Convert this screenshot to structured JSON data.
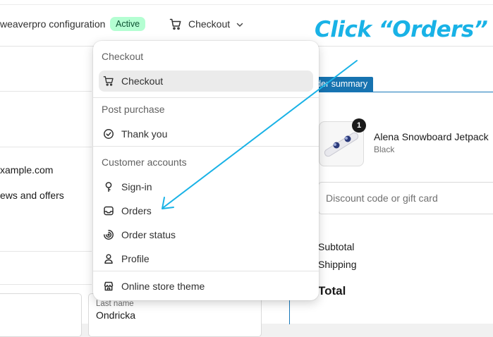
{
  "header": {
    "config_name": "weaverpro configuration",
    "status_badge": "Active",
    "page_select": {
      "label": "Checkout",
      "icon": "cart-icon",
      "chevron": "chevron-down-icon"
    }
  },
  "preview": {
    "left_email": "xample.com",
    "left_newsletter": "ews and offers",
    "last_name": {
      "label": "Last name",
      "value": "Ondricka"
    },
    "order_summary_tab": "rder summary",
    "product": {
      "name": "Alena Snowboard Jetpack",
      "variant": "Black",
      "quantity": "1"
    },
    "discount_placeholder": "Discount code or gift card",
    "subtotal": "Subtotal",
    "shipping": "Shipping",
    "total": "Total"
  },
  "dropdown": {
    "groups": [
      {
        "title": "Checkout",
        "items": [
          {
            "label": "Checkout",
            "icon": "cart-icon",
            "selected": true
          }
        ]
      },
      {
        "title": "Post purchase",
        "items": [
          {
            "label": "Thank you",
            "icon": "check-circle-icon"
          }
        ]
      },
      {
        "title": "Customer accounts",
        "items": [
          {
            "label": "Sign-in",
            "icon": "key-icon"
          },
          {
            "label": "Orders",
            "icon": "inbox-icon"
          },
          {
            "label": "Order status",
            "icon": "order-status-icon"
          },
          {
            "label": "Profile",
            "icon": "person-icon"
          }
        ]
      }
    ],
    "footer_item": {
      "label": "Online store theme",
      "icon": "store-icon"
    }
  },
  "annotation": {
    "text": "Click “Orders”",
    "color": "#19b2e6"
  },
  "colors": {
    "accent_blue": "#1773b0",
    "badge_bg": "#b4fed2",
    "badge_text": "#0c5132"
  }
}
